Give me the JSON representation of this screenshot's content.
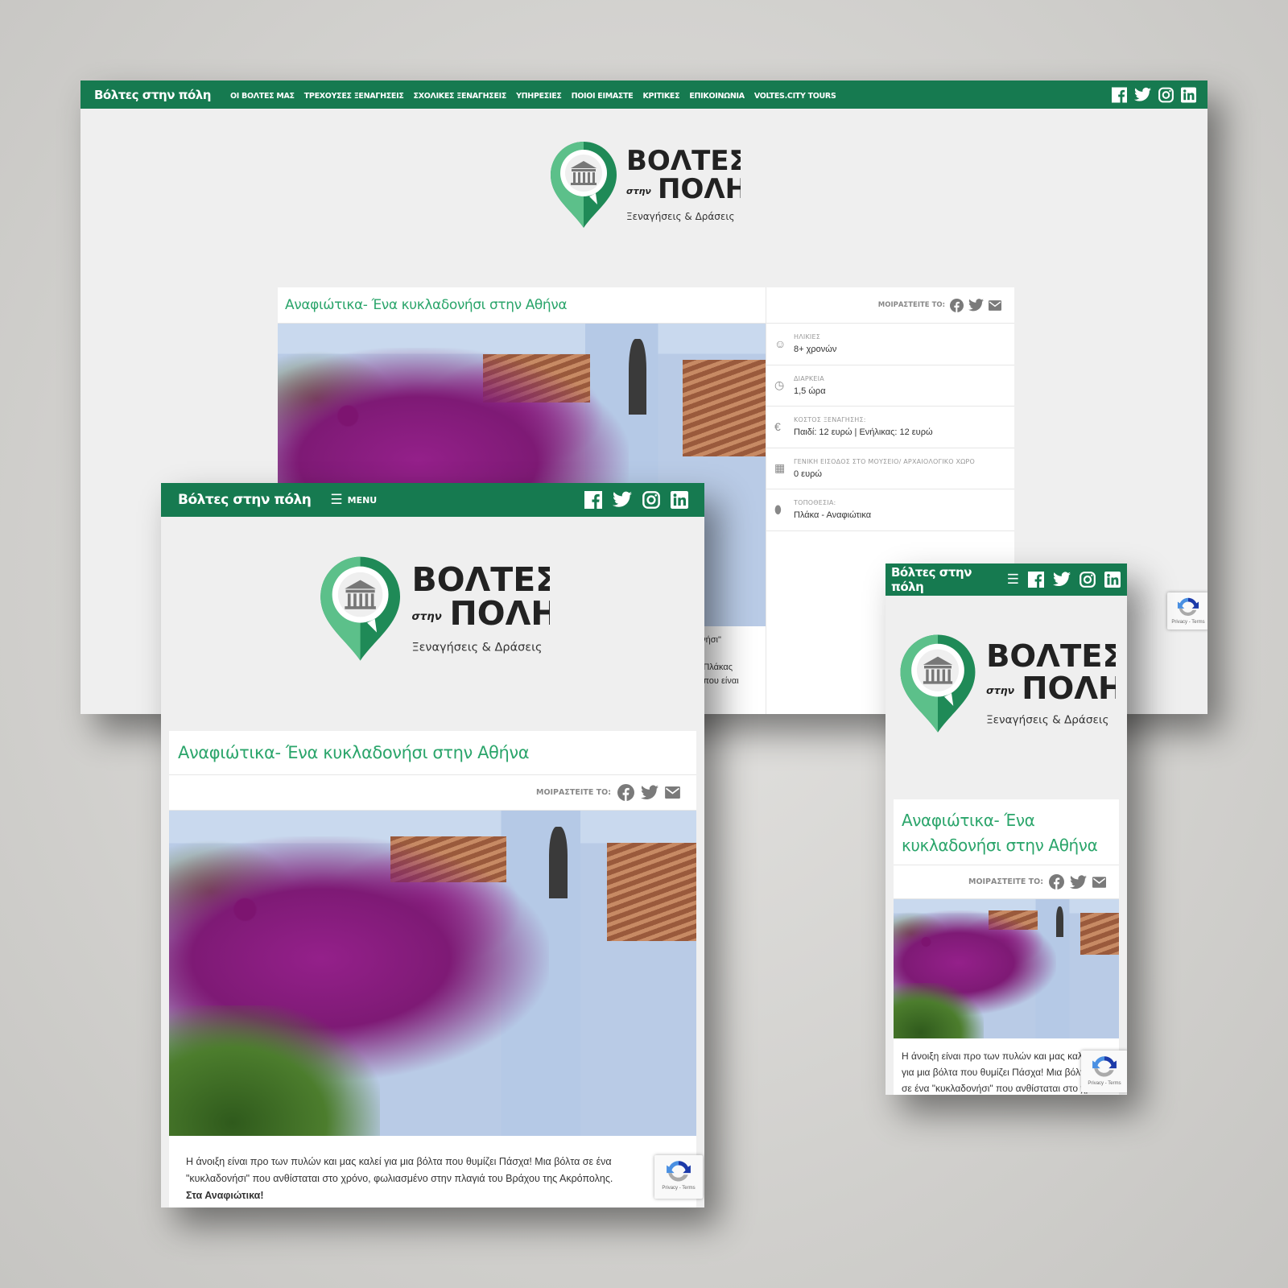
{
  "brand": "Βόλτες στην πόλη",
  "brand_mobile": [
    "Βόλτες στην",
    "πόλη"
  ],
  "menu_label": "MENU",
  "nav_items": [
    "ΟΙ ΒΟΛΤΕΣ ΜΑΣ",
    "ΤΡΕΧΟΥΣΕΣ ΞΕΝΑΓΗΣΕΙΣ",
    "ΣΧΟΛΙΚΕΣ ΞΕΝΑΓΗΣΕΙΣ",
    "ΥΠΗΡΕΣΙΕΣ",
    "ΠΟΙΟΙ ΕΙΜΑΣΤΕ",
    "ΚΡΙΤΙΚΕΣ",
    "ΕΠΙΚΟΙΝΩΝΙΑ",
    "VOLTES.CITY TOURS"
  ],
  "social": [
    "facebook-icon",
    "twitter-icon",
    "instagram-icon",
    "linkedin-icon"
  ],
  "logo": {
    "line1": "ΒΟΛΤΕΣ",
    "small": "στην",
    "line2": "ΠΟΛΗ",
    "tagline": "Ξεναγήσεις & Δράσεις"
  },
  "article": {
    "title": "Αναφιώτικα- Ένα κυκλαδονήσι στην Αθήνα",
    "title_mobile": [
      "Αναφιώτικα- Ένα",
      "κυκλαδονήσι στην Αθήνα"
    ],
    "share_label": "ΜΟΙΡΑΣΤΕΙΤΕ ΤΟ:",
    "body_1": "Η άνοιξη είναι προ των πυλών και μας καλεί για μια βόλτα που θυμίζει Πάσχα! Μια βόλτα σε ένα \"κυκλαδονήσι\" που ανθίσταται στο χρόνο, φωλιασμένο στην πλαγιά του Βράχου της Ακρόπολης.",
    "body_bold": "Στα Αναφιώτικα!",
    "mobile_lines": [
      "Η άνοιξη είναι προ των πυλών και μας καλεί",
      "για μια βόλτα που θυμίζει Πάσχα! Μια βόλτα",
      "σε ένα \"κυκλαδονήσι\" που ανθίσταται στο χρόνο"
    ],
    "desktop_fragments": [
      "ονήσι\"",
      "ς Πλάκας",
      "ς που είναι"
    ]
  },
  "info": [
    {
      "icon": "child-face-icon",
      "label": "ΗΛΙΚΙΕΣ",
      "value": "8+ χρονών"
    },
    {
      "icon": "clock-icon",
      "label": "ΔΙΑΡΚΕΙΑ",
      "value": "1,5 ώρα"
    },
    {
      "icon": "euro-icon",
      "label": "ΚΟΣΤΟΣ ΞΕΝΑΓΗΣΗΣ:",
      "value": "Παιδί: 12 ευρώ | Ενήλικας: 12 ευρώ"
    },
    {
      "icon": "ticket-icon",
      "label": "ΓΕΝΙΚΗ ΕΙΣΟΔΟΣ ΣΤΟ ΜΟΥΣΕΙΟ/ ΑΡΧΑΙΟΛΟΓΙΚΟ ΧΩΡΟ",
      "value": "0 ευρώ"
    },
    {
      "icon": "location-pin-icon",
      "label": "ΤΟΠΟΘΕΣΙΑ:",
      "value": "Πλάκα - Αναφιώτικα"
    }
  ],
  "recaptcha": "Privacy - Terms",
  "colors": {
    "brand_green": "#167a50",
    "title_green": "#2ba56b",
    "logo_light": "#5cc08a",
    "logo_dark": "#1f8a57"
  }
}
